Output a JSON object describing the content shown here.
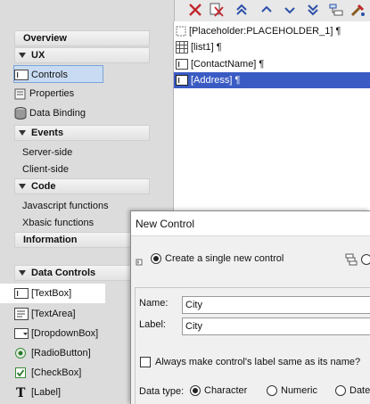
{
  "left_panel": {
    "overview": "Overview",
    "ux": "UX",
    "ux_items": [
      "Controls",
      "Properties",
      "Data Binding"
    ],
    "events": "Events",
    "events_items": [
      "Server-side",
      "Client-side"
    ],
    "code": "Code",
    "code_items": [
      "Javascript functions",
      "Xbasic functions"
    ],
    "information": "Information",
    "data_controls": "Data Controls",
    "data_control_items": [
      "[TextBox]",
      "[TextArea]",
      "[DropdownBox]",
      "[RadioButton]",
      "[CheckBox]",
      "[Label]"
    ]
  },
  "tree": {
    "nodes": [
      "[Placeholder:PLACEHOLDER_1] ¶",
      "[list1] ¶",
      "[ContactName] ¶",
      "[Address] ¶"
    ]
  },
  "dialog": {
    "title": "New Control",
    "create_single": "Create a single new control",
    "name_label": "Name:",
    "name_value": "City",
    "label_label": "Label:",
    "label_value": "City",
    "always_same": "Always make control's label same as its name?",
    "data_type_label": "Data type:",
    "data_types": [
      "Character",
      "Numeric",
      "Date"
    ]
  },
  "colors": {
    "selection": "#3a5bc4",
    "accent_red": "#c0282d",
    "toolbar_blue": "#2b4fa8"
  }
}
